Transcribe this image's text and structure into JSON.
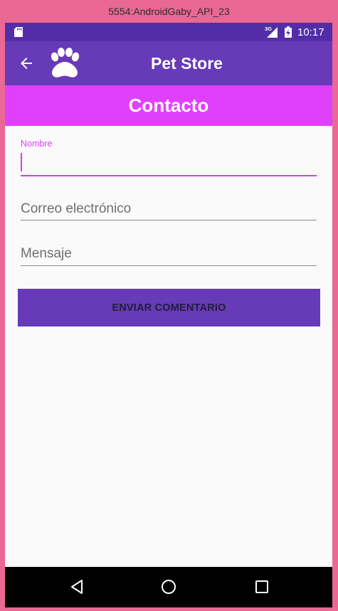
{
  "window": {
    "title": "5554:AndroidGaby_API_23"
  },
  "status_bar": {
    "network": "3G",
    "time": "10:17"
  },
  "toolbar": {
    "title": "Pet Store",
    "icons": {
      "back": "arrow-back-icon",
      "logo": "paw-icon"
    }
  },
  "section": {
    "title": "Contacto"
  },
  "form": {
    "name_label": "Nombre",
    "name_value": "",
    "email_placeholder": "Correo electrónico",
    "message_placeholder": "Mensaje",
    "submit_label": "ENVIAR COMENTARIO"
  },
  "colors": {
    "status_bar": "#512da8",
    "toolbar": "#673ab7",
    "section_header": "#e040fb",
    "accent": "#e040fb",
    "button": "#673ab7"
  },
  "nav": {
    "icons": [
      "nav-back-icon",
      "nav-home-icon",
      "nav-recent-apps-icon"
    ]
  }
}
